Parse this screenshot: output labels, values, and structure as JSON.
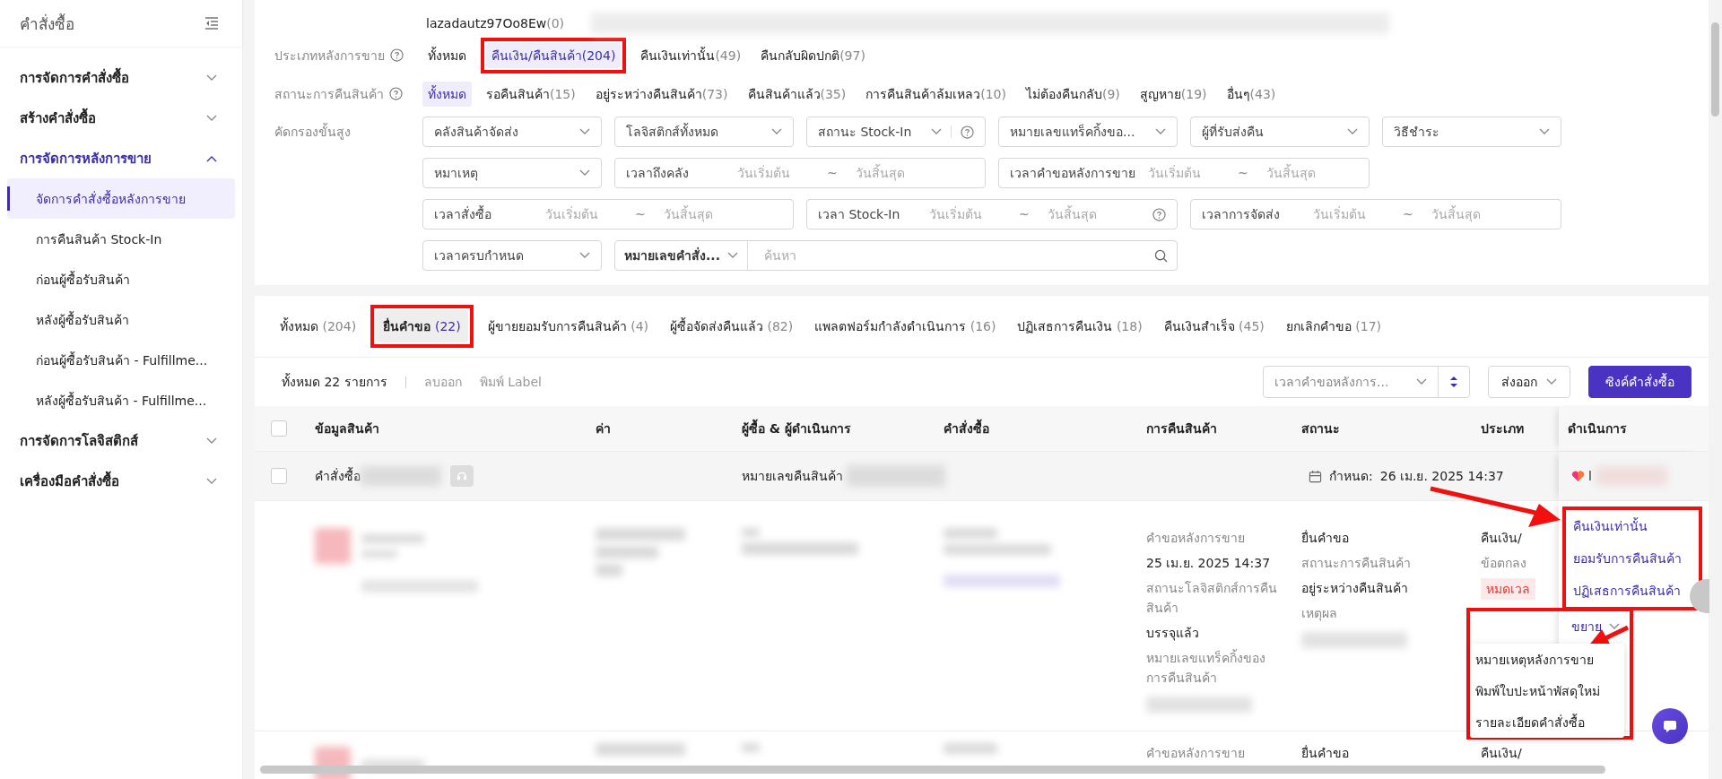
{
  "sidebar": {
    "title": "คำสั่งซื้อ",
    "groups": [
      {
        "label": "การจัดการคำสั่งซื้อ",
        "expanded": false
      },
      {
        "label": "สร้างคำสั่งซื้อ",
        "expanded": false
      },
      {
        "label": "การจัดการหลังการขาย",
        "expanded": true,
        "children": [
          {
            "label": "จัดการคำสั่งซื้อหลังการขาย",
            "selected": true
          },
          {
            "label": "การคืนสินค้า Stock-In",
            "selected": false
          },
          {
            "label": "ก่อนผู้ซื้อรับสินค้า",
            "selected": false
          },
          {
            "label": "หลังผู้ซื้อรับสินค้า",
            "selected": false
          },
          {
            "label": "ก่อนผู้ซื้อรับสินค้า - Fulfillme...",
            "selected": false
          },
          {
            "label": "หลังผู้ซื้อรับสินค้า - Fulfillme...",
            "selected": false
          }
        ]
      },
      {
        "label": "การจัดการโลจิสติกส์",
        "expanded": false
      },
      {
        "label": "เครื่องมือคำสั่งซื้อ",
        "expanded": false
      }
    ]
  },
  "account": {
    "label": "lazadautz97Oo8Ew",
    "count": "(0)"
  },
  "after_sale_type": {
    "label": "ประเภทหลังการขาย",
    "options": [
      {
        "label": "ทั้งหมด",
        "selected": false,
        "highlighted": false
      },
      {
        "label": "คืนเงิน/คืนสินค้า",
        "count": "(204)",
        "selected": true,
        "highlighted": true
      },
      {
        "label": "คืนเงินเท่านั้น",
        "count": "(49)",
        "selected": false,
        "highlighted": false
      },
      {
        "label": "คืนกลับผิดปกติ",
        "count": "(97)",
        "selected": false,
        "highlighted": false
      }
    ]
  },
  "return_status": {
    "label": "สถานะการคืนสินค้า",
    "options": [
      {
        "label": "ทั้งหมด",
        "selected": true,
        "highlighted": false
      },
      {
        "label": "รอคืนสินค้า",
        "count": "(15)",
        "selected": false,
        "highlighted": false
      },
      {
        "label": "อยู่ระหว่างคืนสินค้า",
        "count": "(73)",
        "selected": false,
        "highlighted": false
      },
      {
        "label": "คืนสินค้าแล้ว",
        "count": "(35)",
        "selected": false,
        "highlighted": false
      },
      {
        "label": "การคืนสินค้าล้มเหลว",
        "count": "(10)",
        "selected": false,
        "highlighted": false
      },
      {
        "label": "ไม่ต้องคืนกลับ",
        "count": "(9)",
        "selected": false,
        "highlighted": false
      },
      {
        "label": "สูญหาย",
        "count": "(19)",
        "selected": false,
        "highlighted": false
      },
      {
        "label": "อื่นๆ",
        "count": "(43)",
        "selected": false,
        "highlighted": false
      }
    ]
  },
  "advanced_filter": {
    "label": "คัดกรองขั้นสูง",
    "fields": [
      {
        "kind": "select",
        "label": "คลังสินค้าจัดส่ง"
      },
      {
        "kind": "select",
        "label": "โลจิสติกส์ทั้งหมด"
      },
      {
        "kind": "select",
        "label": "สถานะ Stock-In",
        "help": true
      },
      {
        "kind": "select",
        "label": "หมายเลขแทร็คกิ้งขอ..."
      },
      {
        "kind": "select",
        "label": "ผู้ที่รับส่งคืน"
      },
      {
        "kind": "select",
        "label": "วิธีชำระ"
      },
      {
        "kind": "select",
        "label": "หมาเหตุ"
      },
      {
        "kind": "date_range",
        "label": "เวลาถึงคลัง",
        "start": "วันเริ่มต้น",
        "separator": "~",
        "end": "วันสิ้นสุด"
      },
      {
        "kind": "date_range",
        "label": "เวลาคำขอหลังการขาย",
        "start": "วันเริ่มต้น",
        "separator": "~",
        "end": "วันสิ้นสุด"
      },
      {
        "kind": "date_range",
        "label": "เวลาสั่งซื้อ",
        "start": "วันเริ่มต้น",
        "separator": "~",
        "end": "วันสิ้นสุด"
      },
      {
        "kind": "date_range",
        "label": "เวลา Stock-In",
        "start": "วันเริ่มต้น",
        "separator": "~",
        "end": "วันสิ้นสุด",
        "help": true
      },
      {
        "kind": "date_range",
        "label": "เวลาการจัดส่ง",
        "start": "วันเริ่มต้น",
        "separator": "~",
        "end": "วันสิ้นสุด"
      },
      {
        "kind": "select",
        "label": "เวลาครบกำหนด"
      },
      {
        "kind": "search",
        "label": "หมายเลขคำสั่ง...",
        "placeholder": "ค้นหา"
      }
    ]
  },
  "tabs": [
    {
      "label": "ทั้งหมด",
      "count": "(204)",
      "selected": false,
      "highlighted": false
    },
    {
      "label": "ยื่นคำขอ",
      "count": "(22)",
      "selected": true,
      "highlighted": true
    },
    {
      "label": "ผู้ขายยอมรับการคืนสินค้า",
      "count": "(4)",
      "selected": false,
      "highlighted": false
    },
    {
      "label": "ผู้ซื้อจัดส่งคืนแล้ว",
      "count": "(82)",
      "selected": false,
      "highlighted": false
    },
    {
      "label": "แพลตฟอร์มกำลังดำเนินการ",
      "count": "(16)",
      "selected": false,
      "highlighted": false
    },
    {
      "label": "ปฏิเสธการคืนเงิน",
      "count": "(18)",
      "selected": false,
      "highlighted": false
    },
    {
      "label": "คืนเงินสำเร็จ",
      "count": "(45)",
      "selected": false,
      "highlighted": false
    },
    {
      "label": "ยกเลิกคำขอ",
      "count": "(17)",
      "selected": false,
      "highlighted": false
    }
  ],
  "toolbar": {
    "total": "ทั้งหมด 22 รายการ",
    "actions": [
      "ลบออก",
      "พิมพ์ Label"
    ],
    "sort": "เวลาคำขอหลังการ...",
    "export": "ส่งออก",
    "sync": "ซิงค์คำสั่งซื้อ"
  },
  "table": {
    "select_all_checked": false,
    "columns": [
      "ข้อมูลสินค้า",
      "ค่า",
      "ผู้ซื้อ & ผู้ดำเนินการ",
      "คำสั่งซื้อ",
      "การคืนสินค้า",
      "สถานะ",
      "ประเภท",
      "ดำเนินการ"
    ],
    "group": {
      "checked": false,
      "order_label": "คำสั่งซื้อ",
      "return_label": "หมายเลขคืนสินค้า",
      "deadline_label": "กำหนด:",
      "deadline": "26 เม.ย. 2025 14:37",
      "shop": "l"
    },
    "rows": [
      {
        "return_info": [
          {
            "kind": "label",
            "text": "คำขอหลังการขาย"
          },
          {
            "kind": "value",
            "text": "25 เม.ย. 2025 14:37"
          },
          {
            "kind": "label",
            "text": "สถานะโลจิสติกส์การคืนสินค้า"
          },
          {
            "kind": "value",
            "text": "บรรจุแล้ว"
          },
          {
            "kind": "label",
            "text": "หมายเลขแทร็คกิ้งของการคืนสินค้า"
          },
          {
            "kind": "redacted"
          }
        ],
        "status": [
          {
            "kind": "value",
            "text": "ยื่นคำขอ"
          },
          {
            "kind": "label",
            "text": "สถานะการคืนสินค้า"
          },
          {
            "kind": "value",
            "text": "อยู่ระหว่างคืนสินค้า"
          },
          {
            "kind": "label",
            "text": "เหตุผล"
          },
          {
            "kind": "redacted"
          }
        ],
        "type": [
          {
            "kind": "value",
            "text": "คืนเงิน/"
          },
          {
            "kind": "label",
            "text": "ข้อตกลง"
          },
          {
            "kind": "tag",
            "text": "หมดเวล"
          }
        ],
        "actions": {
          "highlighted": true,
          "links": [
            "คืนเงินเท่านั้น",
            "ยอมรับการคืนสินค้า",
            "ปฏิเสธการคืนสินค้า"
          ],
          "more": "ขยาย",
          "menu_highlighted": true,
          "menu": [
            "หมายเหตุหลังการขาย",
            "พิมพ์ใบปะหน้าพัสดุใหม่",
            "รายละเอียดคำสั่งซื้อ"
          ]
        }
      },
      {
        "return_info": [
          {
            "kind": "label",
            "text": "คำขอหลังการขาย"
          }
        ],
        "status": [
          {
            "kind": "value",
            "text": "ยื่นคำขอ"
          }
        ],
        "type": [
          {
            "kind": "value",
            "text": "คืนเงิน/"
          }
        ]
      }
    ]
  }
}
